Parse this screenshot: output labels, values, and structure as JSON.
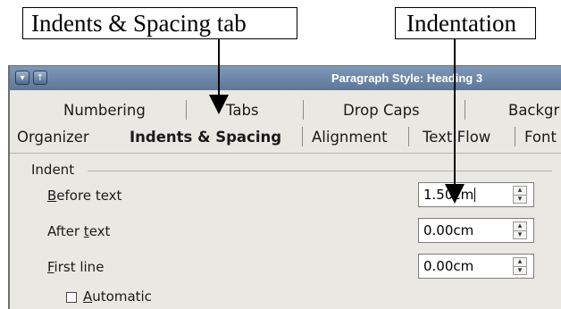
{
  "callouts": {
    "tabs": "Indents & Spacing tab",
    "indentation": "Indentation"
  },
  "window": {
    "title": "Paragraph Style: Heading 3",
    "menu_icon": "chevron-down-icon",
    "up_icon": "arrow-up-icon"
  },
  "tabs": {
    "row1": [
      "Numbering",
      "Tabs",
      "Drop Caps",
      "Backgr"
    ],
    "row2": [
      "Organizer",
      "Indents & Spacing",
      "Alignment",
      "Text Flow",
      "Font"
    ],
    "active": "Indents & Spacing"
  },
  "indent": {
    "group_label": "Indent",
    "before_text": {
      "mnemonic": "B",
      "label_rest": "efore text",
      "value": "1.50cm"
    },
    "after_text": {
      "label_pre": "After ",
      "mnemonic": "t",
      "label_rest": "ext",
      "value": "0.00cm"
    },
    "first_line": {
      "mnemonic": "F",
      "label_rest": "irst line",
      "value": "0.00cm"
    },
    "automatic": {
      "mnemonic": "A",
      "label_rest": "utomatic",
      "checked": false
    }
  }
}
